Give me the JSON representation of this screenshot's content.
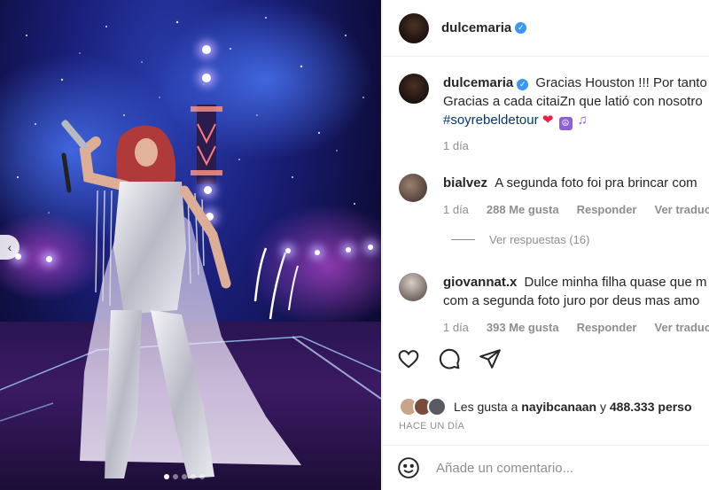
{
  "post": {
    "username": "dulcemaria",
    "caption_line1": "Gracias Houston !!! Por tanto",
    "caption_line2": "Gracias a cada citaiZn que latió con nosotro",
    "hashtag": "#soyrebeldetour",
    "caption_time": "1 día",
    "likes_prefix": "Les gusta a",
    "likes_user": "nayibcanaan",
    "likes_connector": "y",
    "likes_count": "488.333 perso",
    "posted_ago": "HACE UN DÍA",
    "comment_placeholder": "Añade un comentario..."
  },
  "comments": [
    {
      "username": "bialvez",
      "text": "A segunda foto foi pra brincar com",
      "time": "1 día",
      "likes": "288 Me gusta",
      "reply": "Responder",
      "translate": "Ver traducción",
      "view_replies": "Ver respuestas (16)"
    },
    {
      "username": "giovannat.x",
      "text": "Dulce minha filha quase que m",
      "text2": "com a segunda foto juro por deus mas amo",
      "time": "1 día",
      "likes": "393 Me gusta",
      "reply": "Responder",
      "translate": "Ver traducción"
    }
  ],
  "icons": {
    "heart": "heart-icon",
    "comment": "comment-icon",
    "share": "share-icon",
    "emoji": "emoji-icon",
    "verified": "verified-badge-icon",
    "prev": "chevron-left-icon"
  },
  "colors": {
    "verified": "#3897f0",
    "hashtag": "#00376b",
    "muted": "#8e8e8e"
  }
}
